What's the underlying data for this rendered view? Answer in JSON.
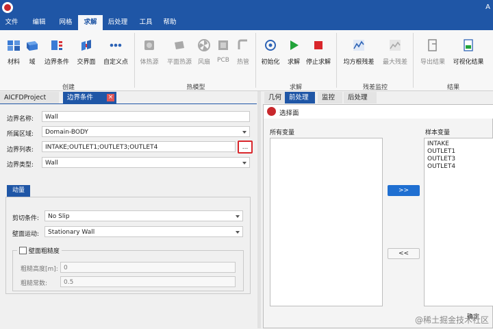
{
  "window": {
    "title_partial": "A"
  },
  "menu": [
    "文件",
    "编辑",
    "网格",
    "求解",
    "后处理",
    "工具",
    "帮助"
  ],
  "ribbon": {
    "groups": {
      "create": {
        "label": "创建",
        "buttons": [
          {
            "label": "材料",
            "icon": "material-icon"
          },
          {
            "label": "域",
            "icon": "domain-icon"
          },
          {
            "label": "边界条件",
            "icon": "boundary-icon"
          },
          {
            "label": "交界面",
            "icon": "interface-icon"
          },
          {
            "label": "自定义点",
            "icon": "custom-point-icon"
          }
        ]
      },
      "thermal": {
        "label": "热模型",
        "buttons": [
          {
            "label": "体热源",
            "icon": "volume-heat-icon"
          },
          {
            "label": "平面热源",
            "icon": "plane-heat-icon"
          },
          {
            "label": "风扇",
            "icon": "fan-icon"
          },
          {
            "label": "PCB",
            "icon": "pcb-icon"
          },
          {
            "label": "热管",
            "icon": "heat-pipe-icon"
          }
        ]
      },
      "solve": {
        "label": "求解",
        "buttons": [
          {
            "label": "初始化",
            "icon": "init-icon"
          },
          {
            "label": "求解",
            "icon": "play-icon"
          },
          {
            "label": "停止求解",
            "icon": "stop-icon"
          }
        ]
      },
      "residual": {
        "label": "残差监控",
        "buttons": [
          {
            "label": "均方根残差",
            "icon": "rms-icon"
          },
          {
            "label": "最大残差",
            "icon": "max-icon"
          }
        ]
      },
      "result": {
        "label": "结果",
        "buttons": [
          {
            "label": "导出结果",
            "icon": "export-icon"
          },
          {
            "label": "可视化结果",
            "icon": "visual-icon"
          }
        ]
      }
    }
  },
  "left_panel": {
    "tabs": [
      "AICFDProject",
      "边界条件"
    ],
    "boundary_name": {
      "label": "边界名称:",
      "value": "Wall"
    },
    "region": {
      "label": "所属区域:",
      "value": "Domain-BODY"
    },
    "boundary_list": {
      "label": "边界列表:",
      "value": "INTAKE;OUTLET1;OUTLET3;OUTLET4",
      "button": "..."
    },
    "boundary_type": {
      "label": "边界类型:",
      "value": "Wall"
    },
    "momentum_tab": "动量",
    "shear_condition": {
      "label": "剪切条件:",
      "value": "No Slip"
    },
    "wall_motion": {
      "label": "壁面运动:",
      "value": "Stationary Wall"
    },
    "roughness": {
      "label": "壁面粗糙度",
      "height_label": "粗糙高度[m]:",
      "height_value": "0",
      "constant_label": "粗糙常数:",
      "constant_value": "0.5"
    }
  },
  "right_panel": {
    "tabs": [
      "几何",
      "前处理",
      "监控",
      "后处理"
    ],
    "dialog": {
      "title": "选择面",
      "all_vars_label": "所有变量",
      "sample_vars_label": "样本变量",
      "sample_vars": [
        "INTAKE",
        "OUTLET1",
        "OUTLET3",
        "OUTLET4"
      ],
      "add_button": ">>",
      "remove_button": "<<",
      "confirm_partial": "确定"
    }
  },
  "watermark": "@稀土掘金技术社区"
}
